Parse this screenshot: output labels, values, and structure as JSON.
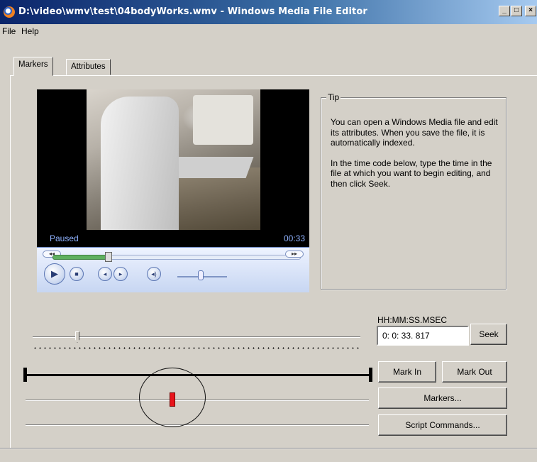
{
  "window": {
    "title": "D:\\video\\wmv\\test\\04bodyWorks.wmv - Windows Media File Editor",
    "minimize_label": "_",
    "maximize_label": "□",
    "close_label": "×"
  },
  "menu": {
    "items": [
      "File",
      "Help"
    ]
  },
  "tabs": [
    {
      "label": "Markers",
      "active": true
    },
    {
      "label": "Attributes",
      "active": false
    }
  ],
  "player": {
    "status": "Paused",
    "time": "00:33",
    "seek_progress": 0.24,
    "volume_level": 0.45
  },
  "tip": {
    "title": "Tip",
    "paragraphs": [
      "You can open a Windows Media file and edit its attributes. When you save the file, it is automatically indexed.",
      "In the time code below, type the time in the file at which you want to begin editing, and then click Seek."
    ]
  },
  "timecode": {
    "label": "HH:MM:SS.MSEC",
    "value": "0:  0: 33. 817",
    "seek_label": "Seek"
  },
  "buttons": {
    "mark_in": "Mark In",
    "mark_out": "Mark Out",
    "markers": "Markers...",
    "script_commands": "Script Commands..."
  },
  "colors": {
    "title_gradient_start": "#0a246a",
    "face": "#d4d0c8",
    "marker": "#e8141c",
    "status_text": "#8fb2ff"
  }
}
